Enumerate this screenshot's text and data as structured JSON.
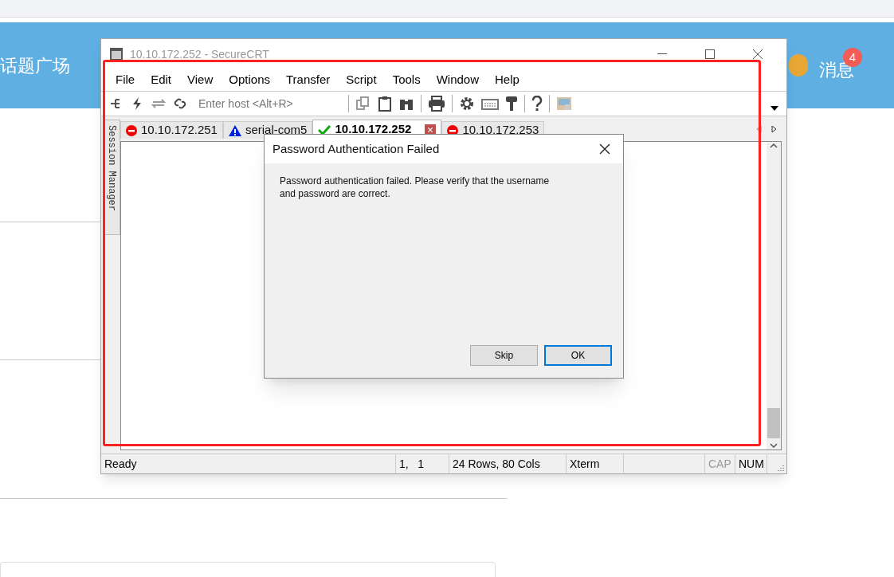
{
  "page": {
    "header_title": "话题广场",
    "messages_label": "消息",
    "messages_count": "4"
  },
  "window": {
    "title": "10.10.172.252 - SecureCRT"
  },
  "menu": [
    "File",
    "Edit",
    "View",
    "Options",
    "Transfer",
    "Script",
    "Tools",
    "Window",
    "Help"
  ],
  "toolbar": {
    "host_placeholder": "Enter host <Alt+R>"
  },
  "tabs": [
    {
      "label": "10.10.172.251",
      "kind": "error",
      "selected": false
    },
    {
      "label": "serial-com5",
      "kind": "warning",
      "selected": false
    },
    {
      "label": "10.10.172.252",
      "kind": "ok",
      "selected": true
    },
    {
      "label": "10.10.172.253",
      "kind": "error",
      "selected": false
    }
  ],
  "session_manager": {
    "label": "Session Manager"
  },
  "dialog": {
    "title": "Password Authentication Failed",
    "message": "Password authentication failed. Please verify that the username and password are correct.",
    "buttons": [
      {
        "label": "Skip",
        "default": false
      },
      {
        "label": "OK",
        "default": true
      }
    ]
  },
  "status_bar": [
    {
      "text": "Ready",
      "active": true
    },
    {
      "text": "1,   1",
      "active": true
    },
    {
      "text": "24 Rows, 80 Cols",
      "active": true
    },
    {
      "text": "Xterm",
      "active": true
    },
    {
      "text": "CAP",
      "active": false
    },
    {
      "text": "NUM",
      "active": true
    }
  ]
}
